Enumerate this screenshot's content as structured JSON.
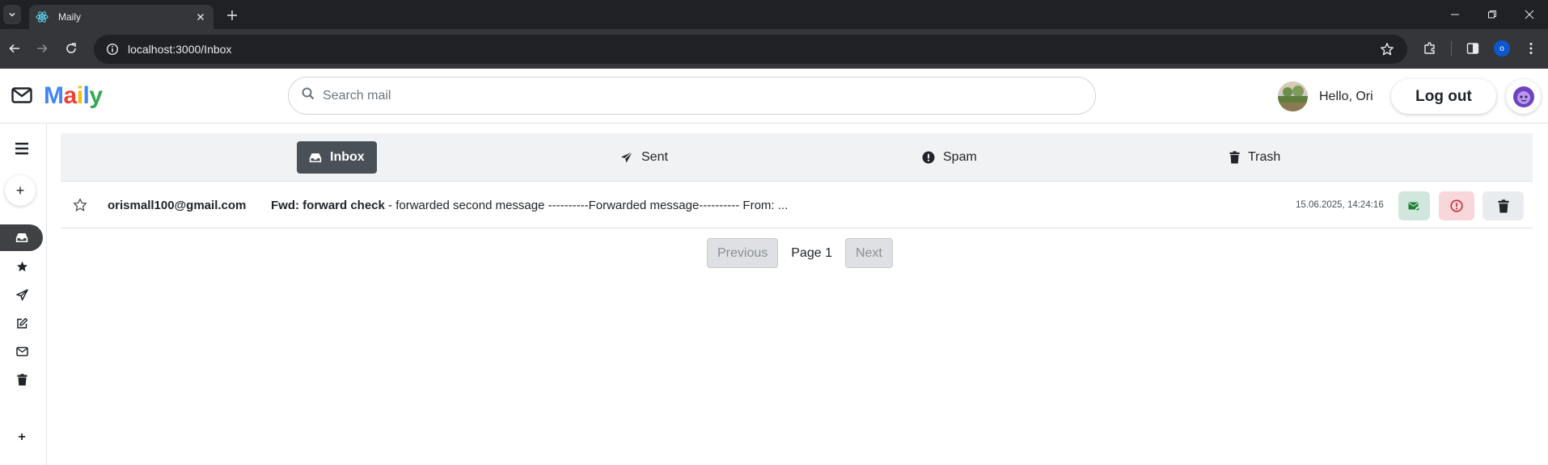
{
  "browser": {
    "tab_title": "Maily",
    "url": "localhost:3000/Inbox",
    "profile_initial": "o"
  },
  "header": {
    "logo_letters": [
      "M",
      "a",
      "i",
      "l",
      "y"
    ],
    "search_placeholder": "Search mail",
    "greeting": "Hello, Ori",
    "logout_label": "Log out"
  },
  "sidebar": {
    "compose_label": "+",
    "add_label": "+",
    "items": [
      "menu-icon",
      "compose-icon",
      "inbox-icon",
      "starred-icon",
      "sent-icon",
      "drafts-icon",
      "all-mail-icon",
      "trash-icon",
      "add-label-icon"
    ]
  },
  "folders": [
    {
      "label": "Inbox",
      "icon": "inbox-icon",
      "active": true
    },
    {
      "label": "Sent",
      "icon": "paper-plane-icon",
      "active": false
    },
    {
      "label": "Spam",
      "icon": "exclamation-circle-icon",
      "active": false
    },
    {
      "label": "Trash",
      "icon": "trash-icon",
      "active": false
    }
  ],
  "mails": [
    {
      "sender": "orismall100@gmail.com",
      "subject": "Fwd: forward check",
      "snippet": " - forwarded second message ----------Forwarded message---------- From: ...",
      "timestamp": "15.06.2025, 14:24:16",
      "starred": false
    }
  ],
  "pagination": {
    "previous_label": "Previous",
    "page_label": "Page 1",
    "next_label": "Next"
  },
  "colors": {
    "active_folder": "#495057",
    "read_button": "#d1e7dd",
    "spam_button": "#f8d7da",
    "trash_button": "#e9ecef"
  }
}
